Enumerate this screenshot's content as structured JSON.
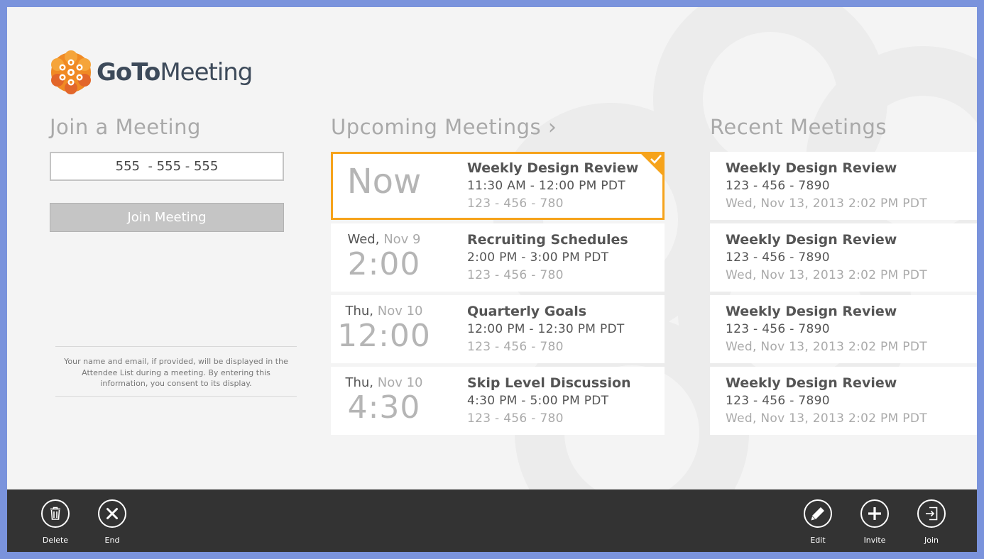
{
  "app": {
    "logo_bold": "GoTo",
    "logo_light": "Meeting"
  },
  "join": {
    "title": "Join a Meeting",
    "input_value": "555  - 555 - 555",
    "button_label": "Join Meeting",
    "consent_text": "Your name and email, if provided, will be displayed in the Attendee List during a meeting. By entering this information, you consent to its display."
  },
  "upcoming": {
    "title": "Upcoming Meetings",
    "chevron": "›",
    "items": [
      {
        "now_label": "Now",
        "title": "Weekly Design Review",
        "time": "11:30 AM - 12:00 PM PDT",
        "id": "123 - 456 - 780"
      },
      {
        "weekday": "Wed,",
        "date": "Nov 9",
        "clock": "2:00",
        "title": "Recruiting Schedules",
        "time": "2:00 PM - 3:00 PM PDT",
        "id": "123 - 456 - 780"
      },
      {
        "weekday": "Thu,",
        "date": "Nov 10",
        "clock": "12:00",
        "title": "Quarterly Goals",
        "time": "12:00 PM - 12:30 PM PDT",
        "id": "123 - 456 - 780"
      },
      {
        "weekday": "Thu,",
        "date": "Nov 10",
        "clock": "4:30",
        "title": "Skip Level Discussion",
        "time": "4:30 PM - 5:00 PM PDT",
        "id": "123 - 456 - 780"
      }
    ]
  },
  "recent": {
    "title": "Recent Meetings",
    "items": [
      {
        "title": "Weekly Design Review",
        "id": "123 - 456 - 7890",
        "when": "Wed, Nov 13, 2013 2:02 PM PDT"
      },
      {
        "title": "Weekly Design Review",
        "id": "123 - 456 - 7890",
        "when": "Wed, Nov 13, 2013 2:02 PM PDT"
      },
      {
        "title": "Weekly Design Review",
        "id": "123 - 456 - 7890",
        "when": "Wed, Nov 13, 2013 2:02 PM PDT"
      },
      {
        "title": "Weekly Design Review",
        "id": "123 - 456 - 7890",
        "when": "Wed, Nov 13, 2013 2:02 PM PDT"
      }
    ]
  },
  "appbar": {
    "delete_label": "Delete",
    "end_label": "End",
    "edit_label": "Edit",
    "invite_label": "Invite",
    "join_label": "Join"
  },
  "colors": {
    "accent": "#f6a31b",
    "logo_orange": "#f08a24",
    "appbar": "#333333",
    "frame": "#7a93dc"
  },
  "icons": {
    "logo": "gotomeeting-flower-icon",
    "selected": "checkmark-icon",
    "delete": "trash-icon",
    "end": "close-icon",
    "edit": "pencil-icon",
    "invite": "plus-icon",
    "join": "sign-in-icon"
  }
}
